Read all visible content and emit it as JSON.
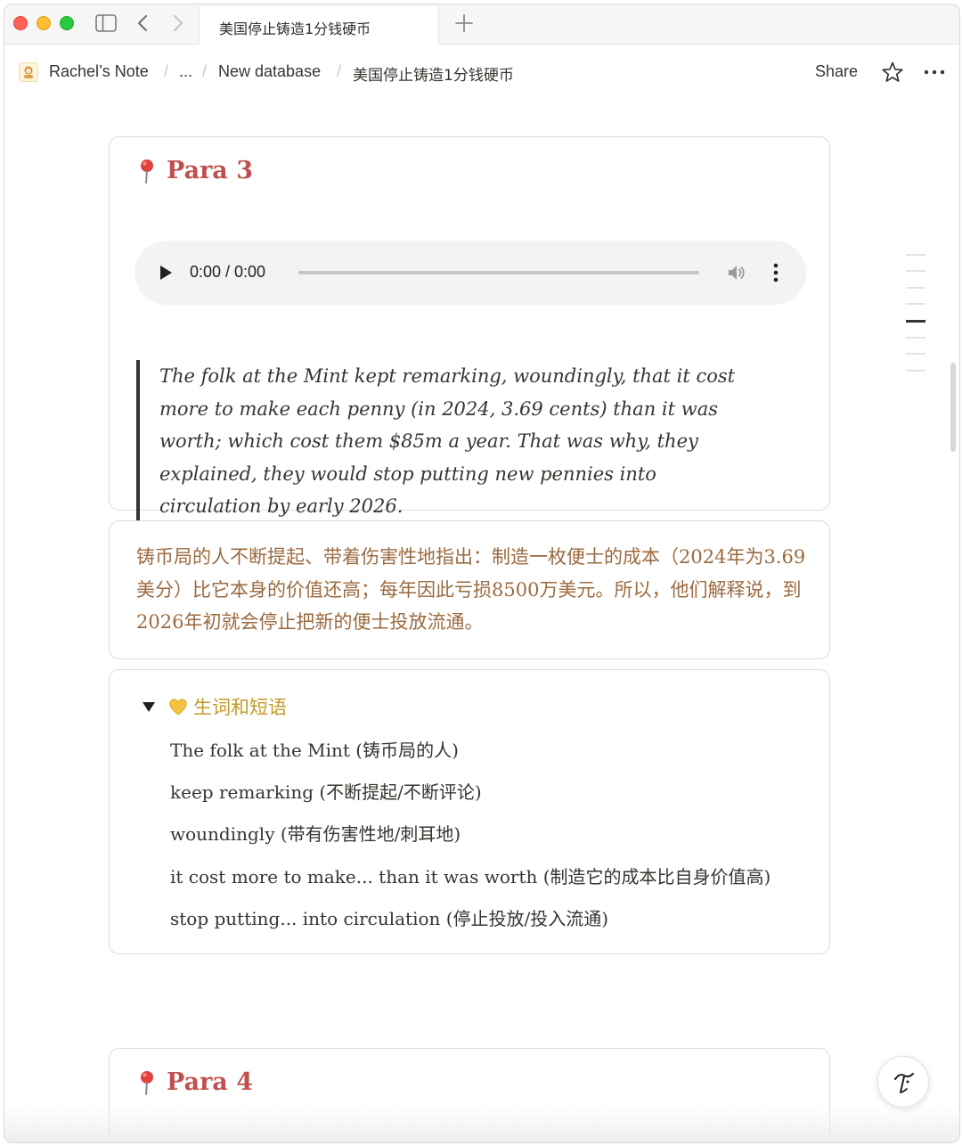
{
  "tab": {
    "title": "美国停止铸造1分钱硬币"
  },
  "breadcrumb": {
    "workspace": "Rachel’s Note",
    "ellipsis": "...",
    "database": "New database",
    "page": "美国停止铸造1分钱硬币",
    "separator": "/"
  },
  "topbar": {
    "share_label": "Share"
  },
  "para3": {
    "title": "Para 3",
    "audio_time": "0:00 / 0:00",
    "quote": "The folk at the Mint kept remarking, woundingly, that it cost more to make each penny (in 2024, 3.69 cents) than it was worth; which cost them $85m a year. That was why, they explained, they would stop putting new pennies into circulation by early 2026.",
    "translation": "铸币局的人不断提起、带着伤害性地指出：制造一枚便士的成本（2024年为3.69美分）比它本身的价值还高；每年因此亏损8500万美元。所以，他们解释说，到2026年初就会停止把新的便士投放流通。"
  },
  "vocab": {
    "title": "生词和短语",
    "items": [
      "The folk at the Mint (铸币局的人)",
      "keep remarking (不断提起/不断评论)",
      "woundingly (带有伤害性地/刺耳地)",
      "it cost more to make... than it was worth (制造它的成本比自身价值高)",
      "stop putting... into circulation (停止投放/投入流通)"
    ]
  },
  "para4": {
    "title": "Para 4"
  },
  "icons": {
    "pin": "round-pushpin-icon",
    "heart": "yellow-heart-icon",
    "play": "play-icon",
    "volume": "volume-icon"
  },
  "colors": {
    "para_title": "#c0504d",
    "translation": "#9b6a3f",
    "toggle_title": "#c29a2a"
  }
}
